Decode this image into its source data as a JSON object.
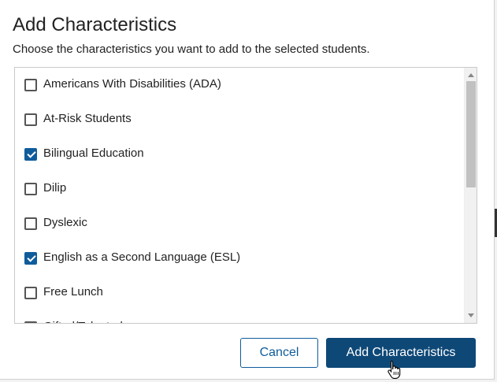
{
  "dialog": {
    "title": "Add Characteristics",
    "subtitle": "Choose the characteristics you want to add to the selected students."
  },
  "characteristics": [
    {
      "label": "Americans With Disabilities (ADA)",
      "checked": false
    },
    {
      "label": "At-Risk Students",
      "checked": false
    },
    {
      "label": "Bilingual Education",
      "checked": true
    },
    {
      "label": "Dilip",
      "checked": false
    },
    {
      "label": "Dyslexic",
      "checked": false
    },
    {
      "label": "English as a Second Language (ESL)",
      "checked": true
    },
    {
      "label": "Free Lunch",
      "checked": false
    },
    {
      "label": "Gifted/Talented",
      "checked": false
    }
  ],
  "buttons": {
    "cancel_label": "Cancel",
    "add_label": "Add Characteristics"
  },
  "colors": {
    "accent": "#0f5c9b",
    "primary_button": "#0e4877"
  }
}
